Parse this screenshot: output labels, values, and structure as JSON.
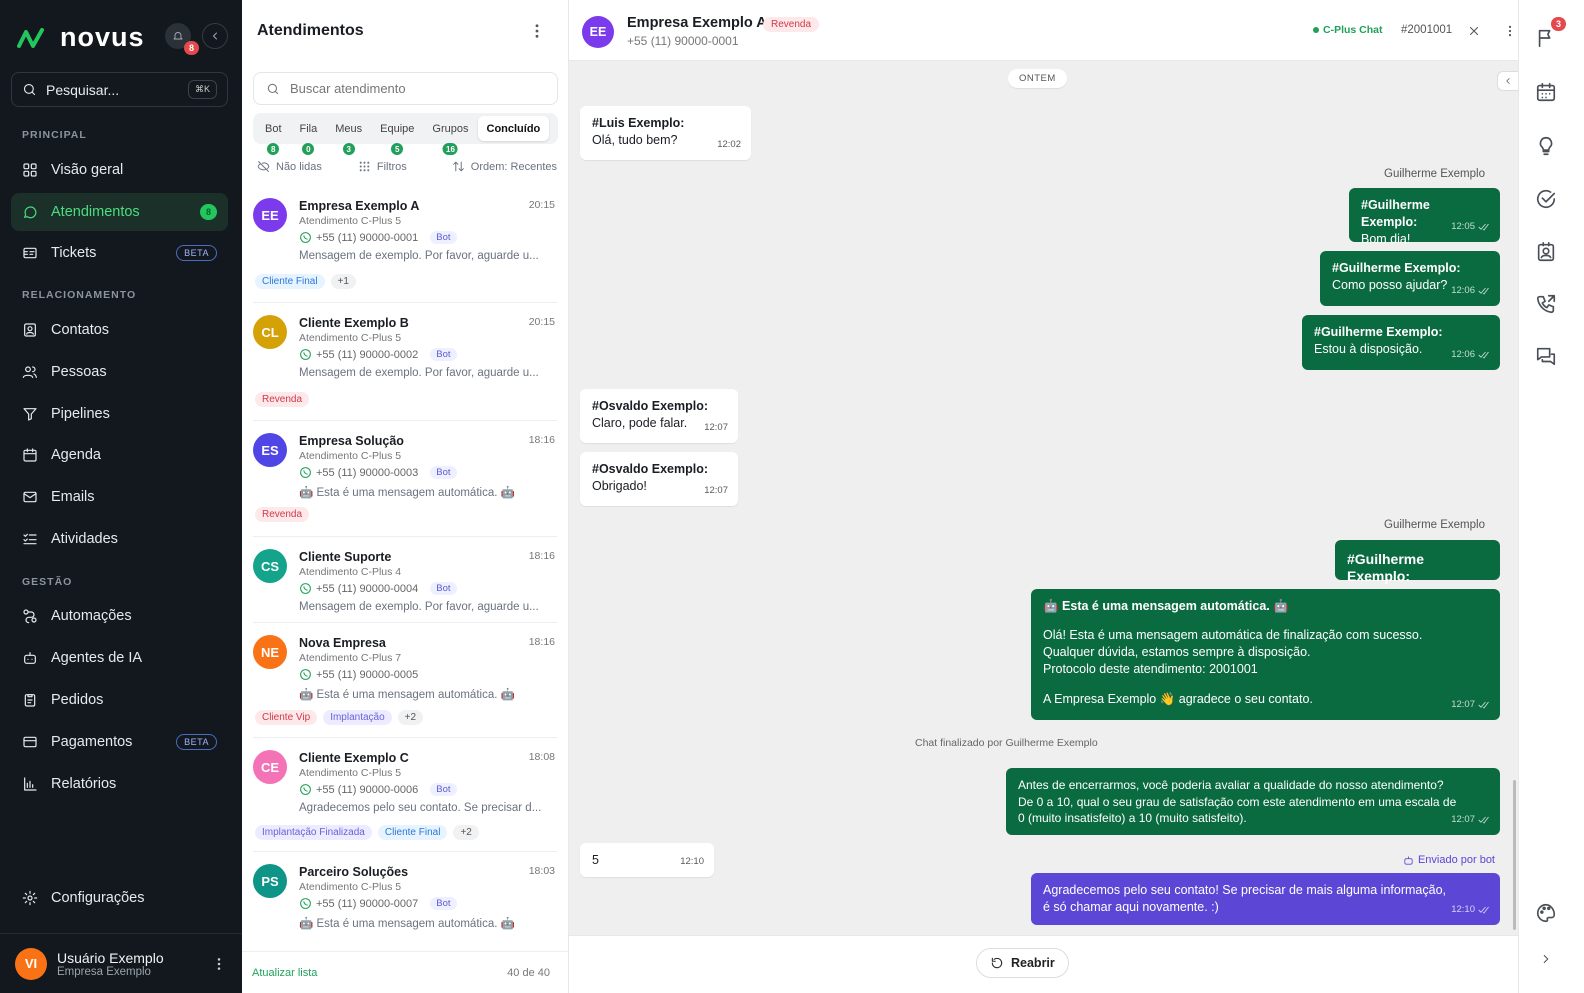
{
  "app": {
    "brand": "novus",
    "notif_count": "8",
    "accent": "#22a05b"
  },
  "sidebar": {
    "search_label": "Pesquisar...",
    "search_kbd": "⌘K",
    "sections": {
      "principal": "PRINCIPAL",
      "relacionamento": "RELACIONAMENTO",
      "gestao": "GESTÃO"
    },
    "items": [
      {
        "label": "Visão geral",
        "icon": "grid-icon"
      },
      {
        "label": "Atendimentos",
        "icon": "chat-bubble-icon",
        "badge": "8",
        "active": true
      },
      {
        "label": "Tickets",
        "icon": "ticket-icon",
        "badge": "BETA"
      },
      {
        "label": "Contatos",
        "icon": "contact-card-icon"
      },
      {
        "label": "Pessoas",
        "icon": "people-icon"
      },
      {
        "label": "Pipelines",
        "icon": "funnel-icon"
      },
      {
        "label": "Agenda",
        "icon": "calendar-icon"
      },
      {
        "label": "Emails",
        "icon": "mail-icon"
      },
      {
        "label": "Atividades",
        "icon": "list-check-icon"
      },
      {
        "label": "Automações",
        "icon": "workflow-icon"
      },
      {
        "label": "Agentes de IA",
        "icon": "robot-icon"
      },
      {
        "label": "Pedidos",
        "icon": "clipboard-icon"
      },
      {
        "label": "Pagamentos",
        "icon": "credit-card-icon",
        "badge": "BETA"
      },
      {
        "label": "Relatórios",
        "icon": "bar-chart-icon"
      }
    ],
    "settings_label": "Configurações",
    "user": {
      "initials": "VI",
      "name": "Usuário Exemplo",
      "company": "Empresa Exemplo"
    }
  },
  "list": {
    "title": "Atendimentos",
    "search_placeholder": "Buscar atendimento",
    "tabs": [
      {
        "label": "Bot",
        "count": "8"
      },
      {
        "label": "Fila",
        "count": "0"
      },
      {
        "label": "Meus",
        "count": "3"
      },
      {
        "label": "Equipe",
        "count": "5"
      },
      {
        "label": "Grupos",
        "count": "16"
      },
      {
        "label": "Concluído",
        "active": true
      }
    ],
    "filters": {
      "unread": "Não lidas",
      "filters": "Filtros",
      "order": "Ordem: Recentes"
    },
    "items": [
      {
        "initials": "EE",
        "color": "#7c3aed",
        "name": "Empresa Exemplo A",
        "time": "20:15",
        "sub": "Atendimento C-Plus 5",
        "phone": "+55 (11) 90000-0001",
        "bot": "Bot",
        "msg": "Mensagem de exemplo. Por favor, aguarde u...",
        "tags": [
          {
            "t": "Cliente Final",
            "c": "blue"
          },
          {
            "t": "+1",
            "c": "gray"
          }
        ]
      },
      {
        "initials": "CL",
        "color": "#d4a106",
        "name": "Cliente Exemplo B",
        "time": "20:15",
        "sub": "Atendimento C-Plus 5",
        "phone": "+55 (11) 90000-0002",
        "bot": "Bot",
        "msg": "Mensagem de exemplo. Por favor, aguarde u...",
        "tags": [
          {
            "t": "Revenda",
            "c": "red"
          }
        ]
      },
      {
        "initials": "ES",
        "color": "#4f46e5",
        "name": "Empresa Solução",
        "time": "18:16",
        "sub": "Atendimento C-Plus 5",
        "phone": "+55 (11) 90000-0003",
        "bot": "Bot",
        "msg": "🤖 Esta é uma mensagem automática. 🤖",
        "tags": [
          {
            "t": "Revenda",
            "c": "red"
          }
        ]
      },
      {
        "initials": "CS",
        "color": "#14a38b",
        "name": "Cliente Suporte",
        "time": "18:16",
        "sub": "Atendimento C-Plus 4",
        "phone": "+55 (11) 90000-0004",
        "bot": "Bot",
        "msg": "Mensagem de exemplo. Por favor, aguarde u...",
        "tags": []
      },
      {
        "initials": "NE",
        "color": "#f97316",
        "name": "Nova Empresa",
        "time": "18:16",
        "sub": "Atendimento C-Plus 7",
        "phone": "+55 (11) 90000-0005",
        "bot": "",
        "msg": "🤖 Esta é uma mensagem automática. 🤖",
        "tags": [
          {
            "t": "Cliente Vip",
            "c": "red"
          },
          {
            "t": "Implantação",
            "c": "pur"
          },
          {
            "t": "+2",
            "c": "gray"
          }
        ]
      },
      {
        "initials": "CE",
        "color": "#f472b6",
        "name": "Cliente Exemplo C",
        "time": "18:08",
        "sub": "Atendimento C-Plus 5",
        "phone": "+55 (11) 90000-0006",
        "bot": "Bot",
        "msg": "Agradecemos pelo seu contato. Se precisar d...",
        "tags": [
          {
            "t": "Implantação Finalizada",
            "c": "pur"
          },
          {
            "t": "Cliente Final",
            "c": "blue"
          },
          {
            "t": "+2",
            "c": "gray"
          }
        ]
      },
      {
        "initials": "PS",
        "color": "#0f9488",
        "name": "Parceiro Soluções",
        "time": "18:03",
        "sub": "Atendimento C-Plus 5",
        "phone": "+55 (11) 90000-0007",
        "bot": "Bot",
        "msg": "🤖 Esta é uma mensagem automática. 🤖",
        "tags": []
      }
    ],
    "refresh": "Atualizar lista",
    "count": "40 de 40"
  },
  "chat": {
    "initials": "EE",
    "name": "Empresa Exemplo A",
    "phone": "+55 (11) 90000-0001",
    "tag": "Revenda",
    "channel": "C-Plus Chat",
    "protocol": "#2001001",
    "day": "ONTEM",
    "sender1": "Guilherme Exemplo",
    "sender2": "Guilherme Exemplo",
    "messages": {
      "m1": {
        "who": "#Luis Exemplo:",
        "text": "Olá, tudo bem?",
        "time": "12:02"
      },
      "m2": {
        "who": "#Guilherme Exemplo:",
        "text": "Bom dia!",
        "time": "12:05"
      },
      "m3": {
        "who": "#Guilherme Exemplo:",
        "text": "Como posso ajudar?",
        "time": "12:06"
      },
      "m4": {
        "who": "#Guilherme Exemplo:",
        "text": "Estou à disposição.",
        "time": "12:06"
      },
      "m5": {
        "who": "#Osvaldo Exemplo:",
        "text": "Claro, pode falar.",
        "time": "12:07"
      },
      "m6": {
        "who": "#Osvaldo Exemplo:",
        "text": "Obrigado!",
        "time": "12:07"
      },
      "m7": {
        "who": "#Guilherme Exemplo:"
      },
      "m8": {
        "title": "🤖 Esta é uma mensagem automática. 🤖",
        "l1": "Olá! Esta é uma mensagem automática de finalização com sucesso.",
        "l2": "Qualquer dúvida, estamos sempre à disposição.",
        "l3": "Protocolo deste atendimento: 2001001",
        "l4": "A Empresa Exemplo 👋 agradece o seu contato.",
        "time": "12:07"
      },
      "m9": {
        "l1": "Antes de encerrarmos, você poderia avaliar a qualidade do nosso atendimento?",
        "l2": "De 0 a 10, qual o seu grau de satisfação com este atendimento em uma escala de",
        "l3": "0 (muito insatisfeito) a 10 (muito satisfeito).",
        "time": "12:07"
      },
      "m10": {
        "text": "5",
        "time": "12:10"
      },
      "m11": {
        "l1": "Agradecemos pelo seu contato! Se precisar de mais alguma informação,",
        "l2": "é só chamar aqui novamente. :)",
        "time": "12:10"
      }
    },
    "system": "Chat finalizado por Guilherme Exemplo",
    "bot_note": "Enviado por bot",
    "reopen": "Reabrir"
  },
  "rail": {
    "flag_count": "3"
  }
}
